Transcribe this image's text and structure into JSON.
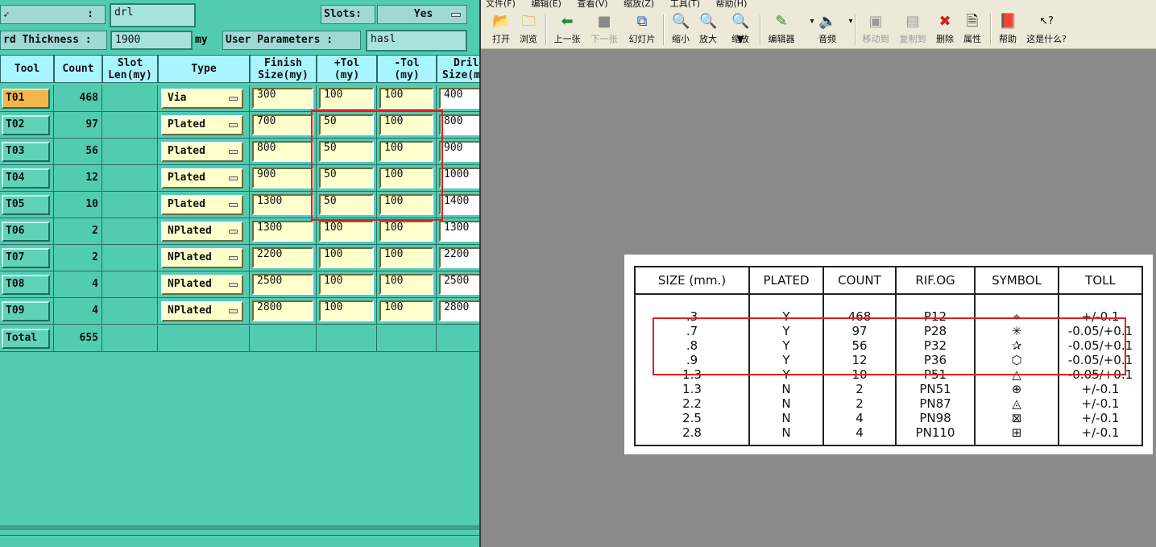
{
  "left": {
    "top_field_value": ":",
    "file_name": "drl",
    "slots_label": "Slots:",
    "slots_value": "Yes",
    "thickness_label": "rd Thickness :",
    "thickness_value": "1900",
    "thickness_unit": "my",
    "user_params_label": "User Parameters :",
    "user_params_value": "hasl",
    "headers": {
      "tool": "Tool",
      "count": "Count",
      "slot1": "Slot",
      "slot2": "Len(my)",
      "type": "Type",
      "finish1": "Finish",
      "finish2": "Size(my)",
      "ptol1": "+Tol",
      "ptol2": "(my)",
      "ntol1": "-Tol",
      "ntol2": "(my)",
      "drill1": "Dril",
      "drill2": "Size(m"
    },
    "rows": [
      {
        "tool": "T01",
        "count": "468",
        "type": "Via",
        "finish": "300",
        "ptol": "100",
        "ntol": "100",
        "drill": "400"
      },
      {
        "tool": "T02",
        "count": "97",
        "type": "Plated",
        "finish": "700",
        "ptol": "50",
        "ntol": "100",
        "drill": "800"
      },
      {
        "tool": "T03",
        "count": "56",
        "type": "Plated",
        "finish": "800",
        "ptol": "50",
        "ntol": "100",
        "drill": "900"
      },
      {
        "tool": "T04",
        "count": "12",
        "type": "Plated",
        "finish": "900",
        "ptol": "50",
        "ntol": "100",
        "drill": "1000"
      },
      {
        "tool": "T05",
        "count": "10",
        "type": "Plated",
        "finish": "1300",
        "ptol": "50",
        "ntol": "100",
        "drill": "1400"
      },
      {
        "tool": "T06",
        "count": "2",
        "type": "NPlated",
        "finish": "1300",
        "ptol": "100",
        "ntol": "100",
        "drill": "1300"
      },
      {
        "tool": "T07",
        "count": "2",
        "type": "NPlated",
        "finish": "2200",
        "ptol": "100",
        "ntol": "100",
        "drill": "2200"
      },
      {
        "tool": "T08",
        "count": "4",
        "type": "NPlated",
        "finish": "2500",
        "ptol": "100",
        "ntol": "100",
        "drill": "2500"
      },
      {
        "tool": "T09",
        "count": "4",
        "type": "NPlated",
        "finish": "2800",
        "ptol": "100",
        "ntol": "100",
        "drill": "2800"
      }
    ],
    "total_label": "Total",
    "total_count": "655"
  },
  "viewer": {
    "menu": [
      "文件(F)",
      "编辑(E)",
      "查看(V)",
      "缩放(Z)",
      "工具(T)",
      "帮助(H)"
    ],
    "toolbar": {
      "open": "打开",
      "browse": "浏览",
      "prev": "上一张",
      "next": "下一张",
      "slideshow": "幻灯片",
      "zoom_out": "缩小",
      "zoom_in": "放大",
      "zoom": "缩放",
      "editor": "编辑器",
      "audio": "音频",
      "move_to": "移动到",
      "copy_to": "复制到",
      "delete": "删除",
      "properties": "属性",
      "help": "帮助",
      "whats_this": "这是什么?"
    },
    "doc_table": {
      "headers": [
        "SIZE (mm.)",
        "PLATED",
        "COUNT",
        "RIF.OG",
        "SYMBOL",
        "TOLL"
      ],
      "rows": [
        [
          ".3",
          "Y",
          "468",
          "P12",
          "⌖",
          "+/-0.1"
        ],
        [
          ".7",
          "Y",
          "97",
          "P28",
          "✳",
          "-0.05/+0.1"
        ],
        [
          ".8",
          "Y",
          "56",
          "P32",
          "✰",
          "-0.05/+0.1"
        ],
        [
          ".9",
          "Y",
          "12",
          "P36",
          "⬡",
          "-0.05/+0.1"
        ],
        [
          "1.3",
          "Y",
          "10",
          "P51",
          "△",
          "-0.05/+0.1"
        ],
        [
          "1.3",
          "N",
          "2",
          "PN51",
          "⊕",
          "+/-0.1"
        ],
        [
          "2.2",
          "N",
          "2",
          "PN87",
          "◬",
          "+/-0.1"
        ],
        [
          "2.5",
          "N",
          "4",
          "PN98",
          "⊠",
          "+/-0.1"
        ],
        [
          "2.8",
          "N",
          "4",
          "PN110",
          "⊞",
          "+/-0.1"
        ]
      ]
    }
  },
  "colors": {
    "panel_bg": "#52ccb0",
    "header_bg": "#a8f4ff",
    "input_bg": "#ffffcc",
    "highlight_red": "#e02020",
    "selected_tool": "#f5b54a",
    "viewer_bg": "#8a8a8a"
  }
}
